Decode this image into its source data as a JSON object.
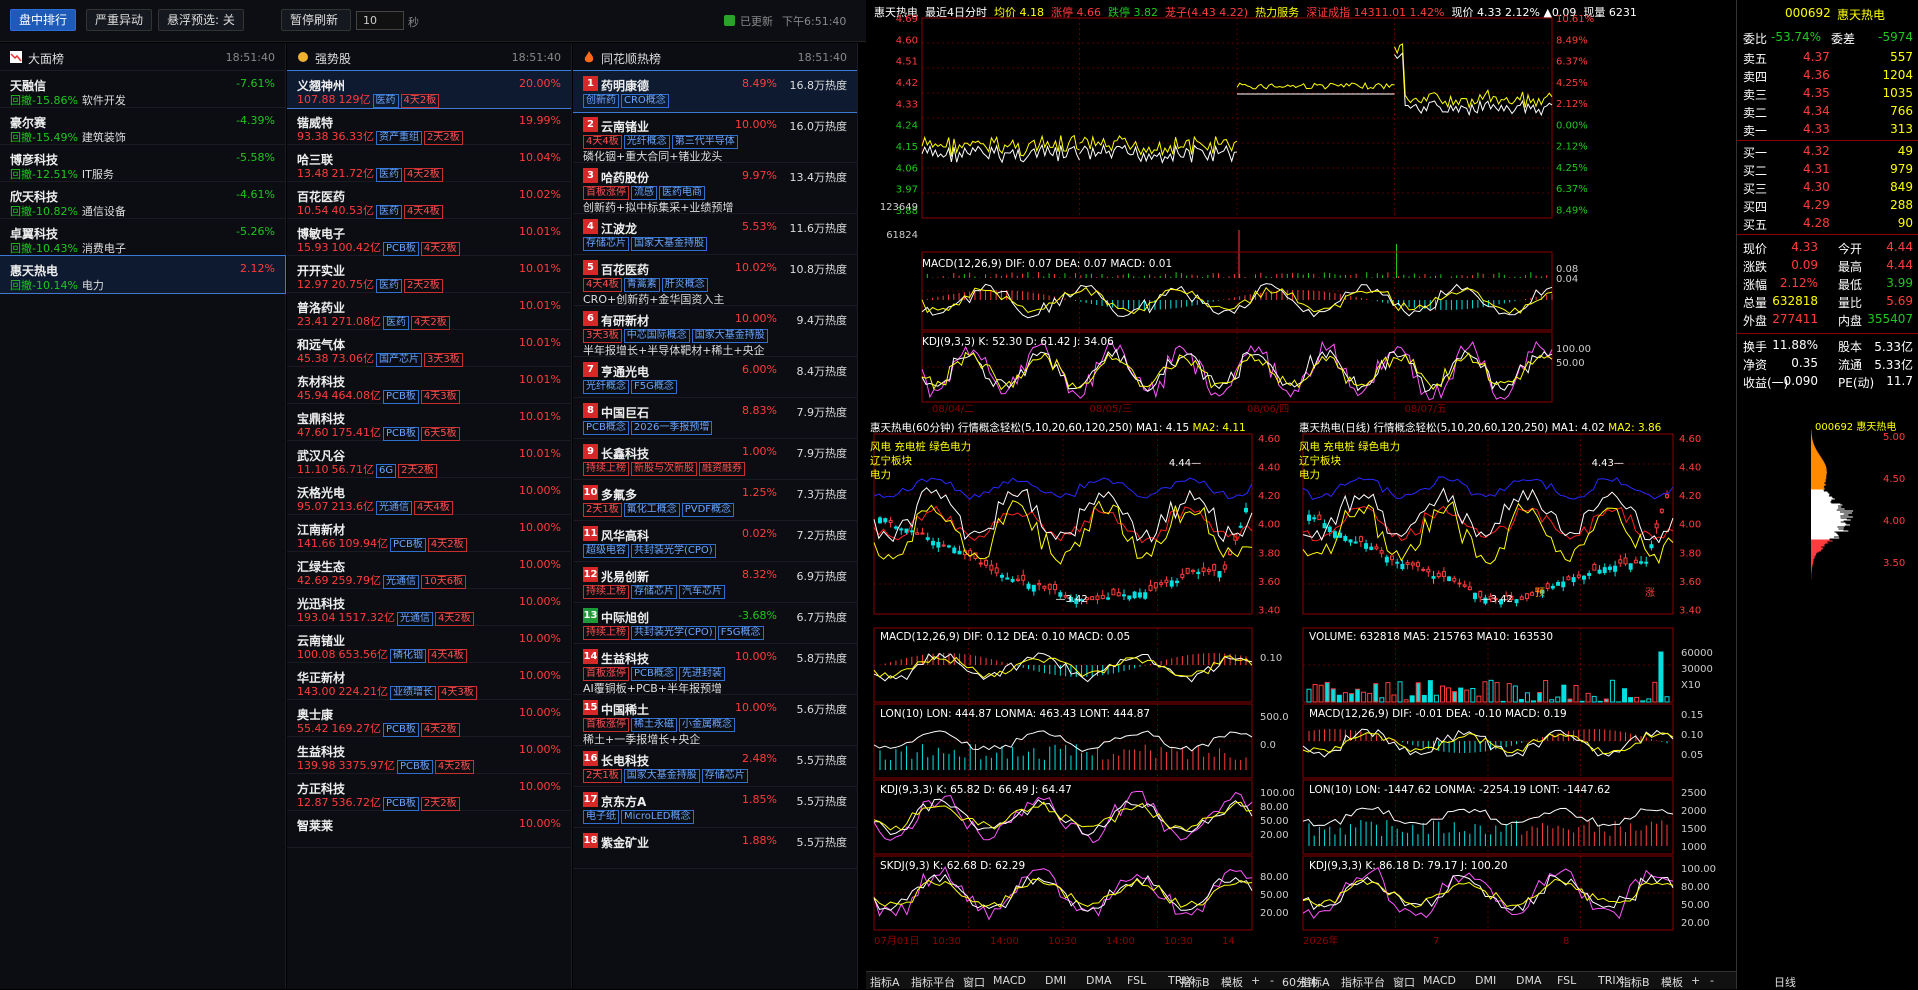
{
  "toolbar": {
    "tab_active": "盘中排行",
    "tab2": "严重异动",
    "float_label": "悬浮预选: 关",
    "pause_label": "暂停刷新",
    "interval": "10",
    "interval_unit": "秒",
    "updated_label": "已更新",
    "updated_time": "下午6:51:40"
  },
  "panel1": {
    "title": "大面榜",
    "time": "18:51:40",
    "items": [
      {
        "name": "天融信",
        "pct": "-7.61%",
        "drawdown": "回撤-15.86%",
        "sector": "软件开发"
      },
      {
        "name": "豪尔赛",
        "pct": "-4.39%",
        "drawdown": "回撤-15.49%",
        "sector": "建筑装饰"
      },
      {
        "name": "博彦科技",
        "pct": "-5.58%",
        "drawdown": "回撤-12.51%",
        "sector": "IT服务"
      },
      {
        "name": "欣天科技",
        "pct": "-4.61%",
        "drawdown": "回撤-10.82%",
        "sector": "通信设备"
      },
      {
        "name": "卓翼科技",
        "pct": "-5.26%",
        "drawdown": "回撤-10.43%",
        "sector": "消费电子"
      },
      {
        "name": "惠天热电",
        "pct": "2.12%",
        "drawdown": "回撤-10.14%",
        "sector": "电力"
      }
    ]
  },
  "panel2": {
    "title": "强势股",
    "time": "18:51:40",
    "items": [
      {
        "name": "义翘神州",
        "pct": "20.00%",
        "price": "107.88",
        "cap": "129亿",
        "tags": [
          "医药"
        ],
        "board": "4天2板"
      },
      {
        "name": "锴威特",
        "pct": "19.99%",
        "price": "93.38",
        "cap": "36.33亿",
        "tags": [
          "资产重组"
        ],
        "board": "2天2板"
      },
      {
        "name": "哈三联",
        "pct": "10.04%",
        "price": "13.48",
        "cap": "21.72亿",
        "tags": [
          "医药"
        ],
        "board": "4天2板"
      },
      {
        "name": "百花医药",
        "pct": "10.02%",
        "price": "10.54",
        "cap": "40.53亿",
        "tags": [
          "医药"
        ],
        "board": "4天4板"
      },
      {
        "name": "博敏电子",
        "pct": "10.01%",
        "price": "15.93",
        "cap": "100.42亿",
        "tags": [
          "PCB板"
        ],
        "board": "4天2板"
      },
      {
        "name": "开开实业",
        "pct": "10.01%",
        "price": "12.97",
        "cap": "20.75亿",
        "tags": [
          "医药"
        ],
        "board": "2天2板"
      },
      {
        "name": "普洛药业",
        "pct": "10.01%",
        "price": "23.41",
        "cap": "271.08亿",
        "tags": [
          "医药"
        ],
        "board": "4天2板"
      },
      {
        "name": "和远气体",
        "pct": "10.01%",
        "price": "45.38",
        "cap": "73.06亿",
        "tags": [
          "国产芯片"
        ],
        "board": "3天3板"
      },
      {
        "name": "东材科技",
        "pct": "10.01%",
        "price": "45.94",
        "cap": "464.08亿",
        "tags": [
          "PCB板"
        ],
        "board": "4天3板"
      },
      {
        "name": "宝鼎科技",
        "pct": "10.01%",
        "price": "47.60",
        "cap": "175.41亿",
        "tags": [
          "PCB板"
        ],
        "board": "6天5板"
      },
      {
        "name": "武汉凡谷",
        "pct": "10.01%",
        "price": "11.10",
        "cap": "56.71亿",
        "tags": [
          "6G"
        ],
        "board": "2天2板"
      },
      {
        "name": "沃格光电",
        "pct": "10.00%",
        "price": "95.07",
        "cap": "213.6亿",
        "tags": [
          "光通信"
        ],
        "board": "4天4板"
      },
      {
        "name": "江南新材",
        "pct": "10.00%",
        "price": "141.66",
        "cap": "109.94亿",
        "tags": [
          "PCB板"
        ],
        "board": "4天2板"
      },
      {
        "name": "汇绿生态",
        "pct": "10.00%",
        "price": "42.69",
        "cap": "259.79亿",
        "tags": [
          "光通信"
        ],
        "board": "10天6板"
      },
      {
        "name": "光迅科技",
        "pct": "10.00%",
        "price": "193.04",
        "cap": "1517.32亿",
        "tags": [
          "光通信"
        ],
        "board": "4天2板"
      },
      {
        "name": "云南锗业",
        "pct": "10.00%",
        "price": "100.08",
        "cap": "653.56亿",
        "tags": [
          "磷化铟"
        ],
        "board": "4天4板"
      },
      {
        "name": "华正新材",
        "pct": "10.00%",
        "price": "143.00",
        "cap": "224.21亿",
        "tags": [
          "业绩增长"
        ],
        "board": "4天3板"
      },
      {
        "name": "奥士康",
        "pct": "10.00%",
        "price": "55.42",
        "cap": "169.27亿",
        "tags": [
          "PCB板"
        ],
        "board": "4天2板"
      },
      {
        "name": "生益科技",
        "pct": "10.00%",
        "price": "139.98",
        "cap": "3375.97亿",
        "tags": [
          "PCB板"
        ],
        "board": "4天2板"
      },
      {
        "name": "方正科技",
        "pct": "10.00%",
        "price": "12.87",
        "cap": "536.72亿",
        "tags": [
          "PCB板"
        ],
        "board": "2天2板"
      },
      {
        "name": "智莱莱",
        "pct": "10.00%",
        "price": "",
        "cap": "",
        "tags": [],
        "board": ""
      }
    ]
  },
  "panel3": {
    "title": "同花顺热榜",
    "time": "18:51:40",
    "items": [
      {
        "rank": "1",
        "name": "药明康德",
        "pct": "8.49%",
        "heat": "16.8万热度",
        "tags": [
          "创新药",
          "CRO概念"
        ],
        "red": [],
        "note": ""
      },
      {
        "rank": "2",
        "name": "云南锗业",
        "pct": "10.00%",
        "heat": "16.0万热度",
        "tags": [
          "光纤概念",
          "第三代半导体"
        ],
        "red": [
          "4天4板"
        ],
        "note": "磷化铟+重大合同+锗业龙头"
      },
      {
        "rank": "3",
        "name": "哈药股份",
        "pct": "9.97%",
        "heat": "13.4万热度",
        "tags": [
          "流感",
          "医药电商"
        ],
        "red": [
          "首板涨停"
        ],
        "note": "创新药+拟中标集采+业绩预增"
      },
      {
        "rank": "4",
        "name": "江波龙",
        "pct": "5.53%",
        "heat": "11.6万热度",
        "tags": [
          "存储芯片",
          "国家大基金持股"
        ],
        "red": [],
        "note": ""
      },
      {
        "rank": "5",
        "name": "百花医药",
        "pct": "10.02%",
        "heat": "10.8万热度",
        "tags": [
          "青蒿素",
          "肝炎概念"
        ],
        "red": [
          "4天4板"
        ],
        "note": "CRO+创新药+金华国资入主"
      },
      {
        "rank": "6",
        "name": "有研新材",
        "pct": "10.00%",
        "heat": "9.4万热度",
        "tags": [
          "中芯国际概念",
          "国家大基金持股"
        ],
        "red": [
          "3天3板"
        ],
        "note": "半年报增长+半导体靶材+稀土+央企"
      },
      {
        "rank": "7",
        "name": "亨通光电",
        "pct": "6.00%",
        "heat": "8.4万热度",
        "tags": [
          "光纤概念",
          "F5G概念"
        ],
        "red": [],
        "note": ""
      },
      {
        "rank": "8",
        "name": "中国巨石",
        "pct": "8.83%",
        "heat": "7.9万热度",
        "tags": [
          "PCB概念",
          "2026一季报预增"
        ],
        "red": [],
        "note": ""
      },
      {
        "rank": "9",
        "name": "长鑫科技",
        "pct": "1.00%",
        "heat": "7.9万热度",
        "tags": [],
        "red": [
          "持续上榜",
          "新股与次新股",
          "融资融券"
        ],
        "note": ""
      },
      {
        "rank": "10",
        "name": "多氟多",
        "pct": "1.25%",
        "heat": "7.3万热度",
        "tags": [
          "氟化工概念",
          "PVDF概念"
        ],
        "red": [
          "2天1板"
        ],
        "note": ""
      },
      {
        "rank": "11",
        "name": "风华高科",
        "pct": "0.02%",
        "heat": "7.2万热度",
        "tags": [
          "超级电容",
          "共封装光学(CPO)"
        ],
        "red": [],
        "note": ""
      },
      {
        "rank": "12",
        "name": "兆易创新",
        "pct": "8.32%",
        "heat": "6.9万热度",
        "tags": [
          "存储芯片",
          "汽车芯片"
        ],
        "red": [
          "持续上榜"
        ],
        "note": ""
      },
      {
        "rank": "13",
        "name": "中际旭创",
        "pct": "-3.68%",
        "heat": "6.7万热度",
        "tags": [
          "共封装光学(CPO)",
          "F5G概念"
        ],
        "red": [
          "持续上榜"
        ],
        "note": ""
      },
      {
        "rank": "14",
        "name": "生益科技",
        "pct": "10.00%",
        "heat": "5.8万热度",
        "tags": [
          "PCB概念",
          "先进封装"
        ],
        "red": [
          "首板涨停"
        ],
        "note": "AI覆铜板+PCB+半年报预增"
      },
      {
        "rank": "15",
        "name": "中国稀土",
        "pct": "10.00%",
        "heat": "5.6万热度",
        "tags": [
          "稀土永磁",
          "小金属概念"
        ],
        "red": [
          "首板涨停"
        ],
        "note": "稀土+一季报增长+央企"
      },
      {
        "rank": "16",
        "name": "长电科技",
        "pct": "2.48%",
        "heat": "5.5万热度",
        "tags": [
          "国家大基金持股",
          "存储芯片"
        ],
        "red": [
          "2天1板"
        ],
        "note": ""
      },
      {
        "rank": "17",
        "name": "京东方A",
        "pct": "1.85%",
        "heat": "5.5万热度",
        "tags": [
          "电子纸",
          "MicroLED概念"
        ],
        "red": [],
        "note": ""
      },
      {
        "rank": "18",
        "name": "紫金矿业",
        "pct": "1.88%",
        "heat": "5.5万热度",
        "tags": [],
        "red": [],
        "note": ""
      }
    ]
  },
  "intraday": {
    "title": "惠天热电",
    "period": "最近4日分时",
    "avg": "均价 4.18",
    "zt": "涨停 4.66",
    "dt": "跌停 3.82",
    "lz": "茏子(4.43 4.22)",
    "sector": "热力服务",
    "index": "深证成指 14311.01 1.42%",
    "cur": "现价 4.33 2.12% ▲0.09",
    "vol": "现量 6231",
    "ylabels": [
      "4.69",
      "4.60",
      "4.51",
      "4.42",
      "4.33",
      "4.24",
      "4.15",
      "4.06",
      "3.97",
      "3.88",
      "123649",
      "61824"
    ],
    "rlabels": [
      "10.61%",
      "8.49%",
      "6.37%",
      "4.25%",
      "2.12%",
      "0.00%",
      "2.12%",
      "4.25%",
      "6.37%",
      "8.49%"
    ],
    "macd": "MACD(12,26,9)  DIF: 0.07  DEA: 0.07  MACD: 0.01",
    "kdj": "KDJ(9,3,3)  K: 52.30  D: 61.42  J: 34.06",
    "macd_r": [
      "0.08",
      "0.04"
    ],
    "kdj_r": [
      "100.00",
      "50.00"
    ],
    "dates": [
      "08/04/二",
      "08/05/三",
      "08/06/四",
      "08/07/五"
    ]
  },
  "k60": {
    "title": "惠天热电(60分钟)",
    "indicator": "行情概念轻松(5,10,20,60,120,250)",
    "ma1": "MA1: 4.15",
    "ma2": "MA2: 4.11",
    "concepts": [
      "风电 充电桩 绿色电力",
      "辽宁板块",
      "电力"
    ],
    "ylabels": [
      "4.60",
      "4.40",
      "4.20",
      "4.00",
      "3.80",
      "3.60",
      "3.40"
    ],
    "hi": "4.44",
    "lo": "3.42",
    "macd": "MACD(12,26,9)  DIF: 0.12  DEA: 0.10  MACD: 0.05",
    "macd_r": "0.10",
    "lon": "LON(10)  LON: 444.87  LONMA: 463.43  LONT: 444.87",
    "lon_r": [
      "500.0",
      "0.0"
    ],
    "kdj": "KDJ(9,3,3)  K: 65.82  D: 66.49  J: 64.47",
    "kdj_r": [
      "100.00",
      "80.00",
      "50.00",
      "20.00"
    ],
    "skdj": "SKDJ(9,3)  K: 62.68  D: 62.29",
    "skdj_r": [
      "80.00",
      "50.00",
      "20.00"
    ],
    "xlabels": [
      "07月01日",
      "10:30",
      "14:00",
      "10:30",
      "14:00",
      "10:30",
      "14"
    ],
    "period": "60分钟"
  },
  "kday": {
    "title": "惠天热电(日线)",
    "indicator": "行情概念轻松(5,10,20,60,120,250)",
    "ma1": "MA1: 4.02",
    "ma2": "MA2: 3.86",
    "concepts": [
      "风电 充电桩 绿色电力",
      "辽宁板块",
      "电力"
    ],
    "ylabels": [
      "4.60",
      "4.40",
      "4.20",
      "4.00",
      "3.80",
      "3.60",
      "3.40"
    ],
    "hi": "4.43",
    "lo": "3.42",
    "yu": "预",
    "zhang": "涨",
    "vol": "VOLUME: 632818  MA5: 215763  MA10: 163530",
    "vol_r": [
      "60000",
      "30000",
      "X10"
    ],
    "macd": "MACD(12,26,9)  DIF: -0.01  DEA: -0.10  MACD: 0.19",
    "macd_r": [
      "0.15",
      "0.10",
      "0.05"
    ],
    "lon": "LON(10)  LON: -1447.62  LONMA: -2254.19  LONT: -1447.62",
    "lon_r": [
      "2500",
      "2000",
      "1500",
      "1000"
    ],
    "kdj": "KDJ(9,3,3)  K: 86.18  D: 79.17  J: 100.20",
    "kdj_r": [
      "100.00",
      "80.00",
      "50.00",
      "20.00"
    ],
    "xlabels": [
      "2026年",
      "7",
      "8"
    ],
    "period": "日线"
  },
  "chip": {
    "code": "000692",
    "name": "惠天热电",
    "ylabels": [
      "5.00",
      "4.50",
      "4.00",
      "3.50"
    ]
  },
  "quote": {
    "code": "000692",
    "name": "惠天热电",
    "webi_label": "委比",
    "webi": "-53.74%",
    "wecha_label": "委差",
    "wecha": "-5974",
    "asks": [
      [
        "卖五",
        "4.37",
        "557"
      ],
      [
        "卖四",
        "4.36",
        "1204"
      ],
      [
        "卖三",
        "4.35",
        "1035"
      ],
      [
        "卖二",
        "4.34",
        "766"
      ],
      [
        "卖一",
        "4.33",
        "313"
      ]
    ],
    "bids": [
      [
        "买一",
        "4.32",
        "49"
      ],
      [
        "买二",
        "4.31",
        "979"
      ],
      [
        "买三",
        "4.30",
        "849"
      ],
      [
        "买四",
        "4.29",
        "288"
      ],
      [
        "买五",
        "4.28",
        "90"
      ]
    ],
    "stats": [
      [
        "现价",
        "4.33",
        "今开",
        "4.44"
      ],
      [
        "涨跌",
        "0.09",
        "最高",
        "4.44"
      ],
      [
        "涨幅",
        "2.12%",
        "最低",
        "3.99"
      ],
      [
        "总量",
        "632818",
        "量比",
        "5.69"
      ],
      [
        "外盘",
        "277411",
        "内盘",
        "355407"
      ]
    ],
    "stats2": [
      [
        "换手",
        "11.88%",
        "股本",
        "5.33亿"
      ],
      [
        "净资",
        "0.35",
        "流通",
        "5.33亿"
      ],
      [
        "收益(一)",
        "0.090",
        "PE(动)",
        "11.7"
      ]
    ]
  },
  "bottom": {
    "left": [
      "指标A",
      "指标平台",
      "窗口",
      "MACD",
      "DMI",
      "DMA",
      "FSL",
      "TRIX"
    ],
    "mid": [
      "指标B",
      "模板",
      "+",
      "-"
    ],
    "right": [
      "指标A",
      "指标平台",
      "窗口",
      "MACD",
      "DMI",
      "DMA",
      "FSL",
      "TRIX"
    ],
    "right2": [
      "指标B",
      "模板",
      "+",
      "-"
    ],
    "rlabel": "日线"
  }
}
